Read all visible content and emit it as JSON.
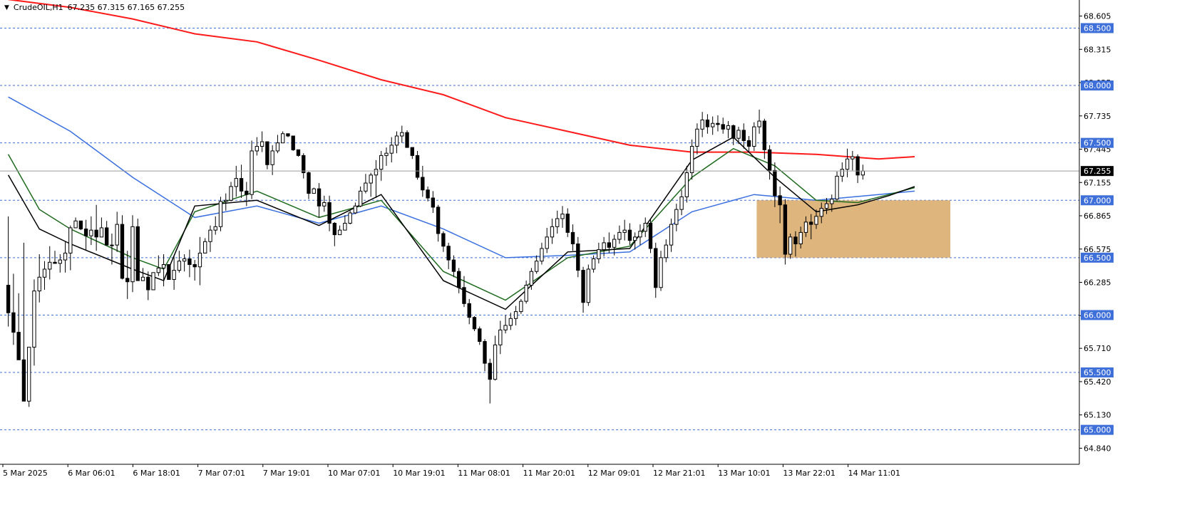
{
  "header": {
    "symbol": "CrudeOIL,H1",
    "ohlc": "67.235 67.315 67.165 67.255"
  },
  "colors": {
    "grid_line": "#3f6fd8",
    "level_label_bg": "#3f6fd8",
    "current_price_bg": "#000000",
    "candle_up": "#ffffff",
    "candle_down": "#000000",
    "ma_red": "#ff1a1a",
    "ma_blue": "#3a6fe0",
    "ma_green": "#1f6b1f",
    "ma_black": "#000000",
    "zone_fill": "#d8a866"
  },
  "chart_data": {
    "type": "candlestick",
    "title": "",
    "symbol": "CrudeOIL",
    "timeframe": "H1",
    "y_range": [
      64.7,
      68.72
    ],
    "y_ticks": [
      "68.605",
      "68.315",
      "68.025",
      "67.735",
      "67.445",
      "67.155",
      "66.865",
      "66.575",
      "66.285",
      "65.995",
      "65.710",
      "65.420",
      "65.130",
      "64.840"
    ],
    "x_ticks": [
      "5 Mar 2025",
      "6 Mar 06:01",
      "6 Mar 18:01",
      "7 Mar 07:01",
      "7 Mar 19:01",
      "10 Mar 07:01",
      "10 Mar 19:01",
      "11 Mar 08:01",
      "11 Mar 20:01",
      "12 Mar 09:01",
      "12 Mar 21:01",
      "13 Mar 10:01",
      "13 Mar 22:01",
      "14 Mar 11:01"
    ],
    "horizontal_levels": [
      "68.500",
      "68.000",
      "67.500",
      "67.000",
      "66.500",
      "66.000",
      "65.500",
      "65.000"
    ],
    "current_price": "67.255",
    "zone": {
      "price_low": 66.5,
      "price_high": 67.0,
      "start_bar": 145,
      "end_bar": 170
    },
    "candles": [
      [
        66.26,
        66.86,
        65.9,
        66.02
      ],
      [
        66.02,
        66.36,
        65.74,
        65.85
      ],
      [
        65.85,
        66.19,
        65.7,
        65.61
      ],
      [
        65.61,
        66.63,
        65.35,
        65.25
      ],
      [
        65.25,
        65.47,
        65.2,
        65.72
      ],
      [
        65.72,
        66.31,
        65.56,
        66.21
      ],
      [
        66.21,
        66.53,
        66.11,
        66.33
      ],
      [
        66.33,
        66.47,
        66.22,
        66.4
      ],
      [
        66.4,
        66.6,
        66.31,
        66.46
      ],
      [
        66.46,
        66.56,
        66.46,
        66.45
      ],
      [
        66.45,
        66.53,
        66.37,
        66.48
      ],
      [
        66.48,
        66.64,
        66.37,
        66.54
      ],
      [
        66.54,
        66.78,
        66.39,
        66.76
      ],
      [
        66.76,
        66.85,
        66.76,
        66.82
      ],
      [
        66.82,
        66.8,
        66.74,
        66.75
      ],
      [
        66.75,
        66.83,
        66.57,
        66.69
      ],
      [
        66.69,
        66.86,
        66.61,
        66.74
      ],
      [
        66.74,
        66.96,
        66.56,
        66.68
      ],
      [
        66.68,
        66.85,
        66.68,
        66.76
      ],
      [
        66.76,
        66.82,
        66.61,
        66.61
      ],
      [
        66.61,
        66.71,
        66.44,
        66.61
      ],
      [
        66.61,
        66.9,
        66.55,
        66.79
      ],
      [
        66.79,
        66.87,
        66.31,
        66.32
      ],
      [
        66.32,
        66.56,
        66.14,
        66.29
      ],
      [
        66.29,
        66.87,
        66.2,
        66.77
      ],
      [
        66.77,
        66.84,
        66.38,
        66.3
      ],
      [
        66.3,
        66.41,
        66.32,
        66.33
      ],
      [
        66.33,
        66.38,
        66.13,
        66.22
      ],
      [
        66.22,
        66.34,
        66.22,
        66.37
      ],
      [
        66.37,
        66.52,
        66.34,
        66.41
      ],
      [
        66.41,
        66.53,
        66.25,
        66.44
      ],
      [
        66.44,
        66.4,
        66.33,
        66.31
      ],
      [
        66.31,
        66.51,
        66.22,
        66.39
      ],
      [
        66.39,
        66.56,
        66.37,
        66.47
      ],
      [
        66.47,
        66.53,
        66.38,
        66.49
      ],
      [
        66.49,
        66.57,
        66.33,
        66.44
      ],
      [
        66.44,
        66.48,
        66.3,
        66.42
      ],
      [
        66.42,
        66.68,
        66.26,
        66.54
      ],
      [
        66.54,
        66.67,
        66.54,
        66.64
      ],
      [
        66.64,
        66.78,
        66.55,
        66.74
      ],
      [
        66.74,
        66.86,
        66.7,
        66.77
      ],
      [
        66.77,
        67.03,
        66.73,
        66.99
      ],
      [
        66.99,
        67.06,
        66.91,
        67.0
      ],
      [
        67.0,
        67.16,
        66.99,
        67.12
      ],
      [
        67.12,
        67.3,
        67.03,
        67.19
      ],
      [
        67.19,
        67.31,
        67.02,
        67.08
      ],
      [
        67.08,
        67.16,
        66.95,
        67.05
      ],
      [
        67.05,
        67.52,
        67.01,
        67.43
      ],
      [
        67.43,
        67.55,
        67.39,
        67.47
      ],
      [
        67.47,
        67.6,
        67.42,
        67.51
      ],
      [
        67.51,
        67.47,
        67.27,
        67.31
      ],
      [
        67.31,
        67.48,
        67.22,
        67.43
      ],
      [
        67.43,
        67.57,
        67.41,
        67.5
      ],
      [
        67.5,
        67.6,
        67.5,
        67.58
      ],
      [
        67.58,
        67.57,
        67.55,
        67.56
      ],
      [
        67.56,
        67.54,
        67.43,
        67.44
      ],
      [
        67.44,
        67.43,
        67.38,
        67.39
      ],
      [
        67.39,
        67.41,
        67.19,
        67.24
      ],
      [
        67.24,
        67.25,
        67.01,
        67.06
      ],
      [
        67.06,
        67.11,
        67.08,
        67.1
      ],
      [
        67.1,
        67.15,
        66.85,
        66.95
      ],
      [
        66.95,
        67.04,
        66.9,
        66.98
      ],
      [
        66.98,
        67.04,
        66.73,
        66.8
      ],
      [
        66.8,
        66.81,
        66.6,
        66.7
      ],
      [
        66.7,
        66.78,
        66.7,
        66.74
      ],
      [
        66.74,
        66.87,
        66.74,
        66.8
      ],
      [
        66.8,
        66.91,
        66.79,
        66.89
      ],
      [
        66.89,
        66.98,
        66.88,
        66.95
      ],
      [
        66.95,
        67.12,
        66.94,
        67.08
      ],
      [
        67.08,
        67.23,
        67.06,
        67.15
      ],
      [
        67.15,
        67.24,
        67.03,
        67.22
      ],
      [
        67.22,
        67.35,
        67.02,
        67.27
      ],
      [
        67.27,
        67.43,
        67.17,
        67.39
      ],
      [
        67.39,
        67.46,
        67.3,
        67.41
      ],
      [
        67.41,
        67.55,
        67.33,
        67.48
      ],
      [
        67.48,
        67.6,
        67.41,
        67.56
      ],
      [
        67.56,
        67.65,
        67.5,
        67.59
      ],
      [
        67.59,
        67.61,
        67.46,
        67.46
      ],
      [
        67.46,
        67.45,
        67.36,
        67.39
      ],
      [
        67.39,
        67.43,
        67.18,
        67.2
      ],
      [
        67.2,
        67.3,
        67.03,
        67.09
      ],
      [
        67.09,
        67.12,
        66.99,
        67.02
      ],
      [
        67.02,
        67.08,
        66.89,
        66.94
      ],
      [
        66.94,
        66.96,
        66.64,
        66.71
      ],
      [
        66.71,
        66.73,
        66.55,
        66.6
      ],
      [
        66.6,
        66.63,
        66.4,
        66.48
      ],
      [
        66.48,
        66.52,
        66.33,
        66.38
      ],
      [
        66.38,
        66.41,
        66.19,
        66.24
      ],
      [
        66.24,
        66.34,
        66.07,
        66.1
      ],
      [
        66.1,
        66.14,
        65.92,
        65.98
      ],
      [
        65.98,
        65.99,
        65.86,
        65.88
      ],
      [
        65.88,
        65.9,
        65.74,
        65.77
      ],
      [
        65.77,
        65.79,
        65.51,
        65.58
      ],
      [
        65.58,
        65.62,
        65.23,
        65.44
      ],
      [
        65.44,
        65.82,
        65.43,
        65.74
      ],
      [
        65.74,
        65.95,
        65.66,
        65.87
      ],
      [
        65.87,
        66.0,
        65.84,
        65.91
      ],
      [
        65.91,
        66.02,
        65.87,
        65.97
      ],
      [
        65.97,
        66.08,
        65.91,
        66.03
      ],
      [
        66.03,
        66.14,
        66.01,
        66.12
      ],
      [
        66.12,
        66.3,
        66.1,
        66.26
      ],
      [
        66.26,
        66.41,
        66.22,
        66.38
      ],
      [
        66.38,
        66.52,
        66.36,
        66.47
      ],
      [
        66.47,
        66.63,
        66.44,
        66.58
      ],
      [
        66.58,
        66.76,
        66.54,
        66.68
      ],
      [
        66.68,
        66.84,
        66.62,
        66.77
      ],
      [
        66.77,
        66.91,
        66.71,
        66.84
      ],
      [
        66.84,
        66.95,
        66.76,
        66.88
      ],
      [
        66.88,
        66.93,
        66.68,
        66.72
      ],
      [
        66.72,
        66.79,
        66.56,
        66.62
      ],
      [
        66.62,
        66.68,
        66.33,
        66.39
      ],
      [
        66.39,
        66.42,
        66.02,
        66.11
      ],
      [
        66.11,
        66.44,
        66.08,
        66.4
      ],
      [
        66.4,
        66.52,
        66.37,
        66.49
      ],
      [
        66.49,
        66.63,
        66.45,
        66.57
      ],
      [
        66.57,
        66.68,
        66.51,
        66.63
      ],
      [
        66.63,
        66.72,
        66.54,
        66.59
      ],
      [
        66.59,
        66.7,
        66.52,
        66.66
      ],
      [
        66.66,
        66.78,
        66.62,
        66.72
      ],
      [
        66.72,
        66.83,
        66.65,
        66.74
      ],
      [
        66.74,
        66.8,
        66.61,
        66.65
      ],
      [
        66.65,
        66.72,
        66.57,
        66.68
      ],
      [
        66.68,
        66.79,
        66.61,
        66.73
      ],
      [
        66.73,
        66.85,
        66.68,
        66.8
      ],
      [
        66.8,
        66.84,
        66.54,
        66.58
      ],
      [
        66.58,
        66.63,
        66.15,
        66.24
      ],
      [
        66.24,
        66.56,
        66.21,
        66.5
      ],
      [
        66.5,
        66.66,
        66.46,
        66.61
      ],
      [
        66.61,
        66.84,
        66.55,
        66.79
      ],
      [
        66.79,
        66.97,
        66.73,
        66.92
      ],
      [
        66.92,
        67.09,
        66.87,
        67.03
      ],
      [
        67.03,
        67.3,
        66.98,
        67.24
      ],
      [
        67.24,
        67.53,
        67.18,
        67.47
      ],
      [
        67.47,
        67.67,
        67.4,
        67.62
      ],
      [
        67.62,
        67.77,
        67.55,
        67.7
      ],
      [
        67.7,
        67.75,
        67.58,
        67.64
      ],
      [
        67.64,
        67.73,
        67.57,
        67.67
      ],
      [
        67.67,
        67.74,
        67.6,
        67.66
      ],
      [
        67.66,
        67.72,
        67.58,
        67.62
      ],
      [
        67.62,
        67.69,
        67.54,
        67.65
      ],
      [
        67.65,
        67.66,
        67.48,
        67.54
      ],
      [
        67.54,
        67.64,
        67.49,
        67.61
      ],
      [
        67.61,
        67.67,
        67.45,
        67.52
      ],
      [
        67.52,
        67.56,
        67.42,
        67.47
      ],
      [
        67.47,
        67.68,
        67.43,
        67.64
      ],
      [
        67.64,
        67.79,
        67.58,
        67.69
      ],
      [
        67.69,
        67.71,
        67.36,
        67.44
      ],
      [
        67.44,
        67.48,
        67.18,
        67.26
      ],
      [
        67.26,
        67.33,
        66.94,
        67.04
      ],
      [
        67.04,
        67.12,
        66.8,
        66.96
      ],
      [
        66.96,
        67.01,
        66.44,
        66.53
      ],
      [
        66.53,
        66.71,
        66.49,
        66.68
      ],
      [
        66.68,
        66.73,
        66.51,
        66.62
      ],
      [
        66.62,
        66.77,
        66.58,
        66.72
      ],
      [
        66.72,
        66.86,
        66.68,
        66.81
      ],
      [
        66.81,
        66.88,
        66.66,
        66.79
      ],
      [
        66.79,
        66.92,
        66.75,
        66.86
      ],
      [
        66.86,
        66.98,
        66.8,
        66.93
      ],
      [
        66.93,
        67.02,
        66.88,
        66.97
      ],
      [
        66.97,
        67.05,
        66.9,
        67.01
      ],
      [
        67.01,
        67.25,
        66.99,
        67.21
      ],
      [
        67.21,
        67.33,
        67.16,
        67.27
      ],
      [
        67.27,
        67.45,
        67.2,
        67.36
      ],
      [
        67.36,
        67.43,
        67.26,
        67.38
      ],
      [
        67.38,
        67.4,
        67.15,
        67.22
      ],
      [
        67.22,
        67.31,
        67.18,
        67.255
      ]
    ],
    "moving_averages": [
      {
        "color": "#ff1a1a",
        "values": [
          [
            0,
            68.75
          ],
          [
            12,
            68.68
          ],
          [
            24,
            68.58
          ],
          [
            36,
            68.45
          ],
          [
            48,
            68.38
          ],
          [
            60,
            68.22
          ],
          [
            72,
            68.05
          ],
          [
            84,
            67.92
          ],
          [
            96,
            67.72
          ],
          [
            108,
            67.6
          ],
          [
            120,
            67.48
          ],
          [
            132,
            67.42
          ],
          [
            144,
            67.42
          ],
          [
            156,
            67.4
          ],
          [
            168,
            67.36
          ],
          [
            175,
            67.38
          ]
        ]
      },
      {
        "color": "#3a6fe0",
        "values": [
          [
            0,
            67.9
          ],
          [
            12,
            67.6
          ],
          [
            24,
            67.2
          ],
          [
            36,
            66.85
          ],
          [
            48,
            66.95
          ],
          [
            60,
            66.8
          ],
          [
            72,
            66.95
          ],
          [
            84,
            66.75
          ],
          [
            96,
            66.5
          ],
          [
            108,
            66.52
          ],
          [
            120,
            66.55
          ],
          [
            132,
            66.9
          ],
          [
            144,
            67.05
          ],
          [
            156,
            67.0
          ],
          [
            168,
            67.05
          ],
          [
            175,
            67.08
          ]
        ]
      },
      {
        "color": "#1f6b1f",
        "values": [
          [
            0,
            67.4
          ],
          [
            6,
            66.92
          ],
          [
            12,
            66.75
          ],
          [
            24,
            66.5
          ],
          [
            30,
            66.4
          ],
          [
            36,
            66.9
          ],
          [
            48,
            67.08
          ],
          [
            60,
            66.85
          ],
          [
            72,
            67.0
          ],
          [
            84,
            66.38
          ],
          [
            96,
            66.13
          ],
          [
            108,
            66.5
          ],
          [
            120,
            66.6
          ],
          [
            132,
            67.2
          ],
          [
            140,
            67.45
          ],
          [
            148,
            67.3
          ],
          [
            156,
            67.0
          ],
          [
            164,
            66.98
          ],
          [
            170,
            67.05
          ],
          [
            175,
            67.11
          ]
        ]
      },
      {
        "color": "#000000",
        "values": [
          [
            0,
            67.22
          ],
          [
            6,
            66.75
          ],
          [
            12,
            66.62
          ],
          [
            24,
            66.4
          ],
          [
            30,
            66.3
          ],
          [
            36,
            66.95
          ],
          [
            48,
            67.0
          ],
          [
            60,
            66.78
          ],
          [
            72,
            67.05
          ],
          [
            84,
            66.3
          ],
          [
            96,
            66.05
          ],
          [
            108,
            66.55
          ],
          [
            120,
            66.58
          ],
          [
            132,
            67.35
          ],
          [
            140,
            67.55
          ],
          [
            148,
            67.2
          ],
          [
            156,
            66.9
          ],
          [
            164,
            66.96
          ],
          [
            170,
            67.04
          ],
          [
            175,
            67.12
          ]
        ]
      }
    ]
  }
}
